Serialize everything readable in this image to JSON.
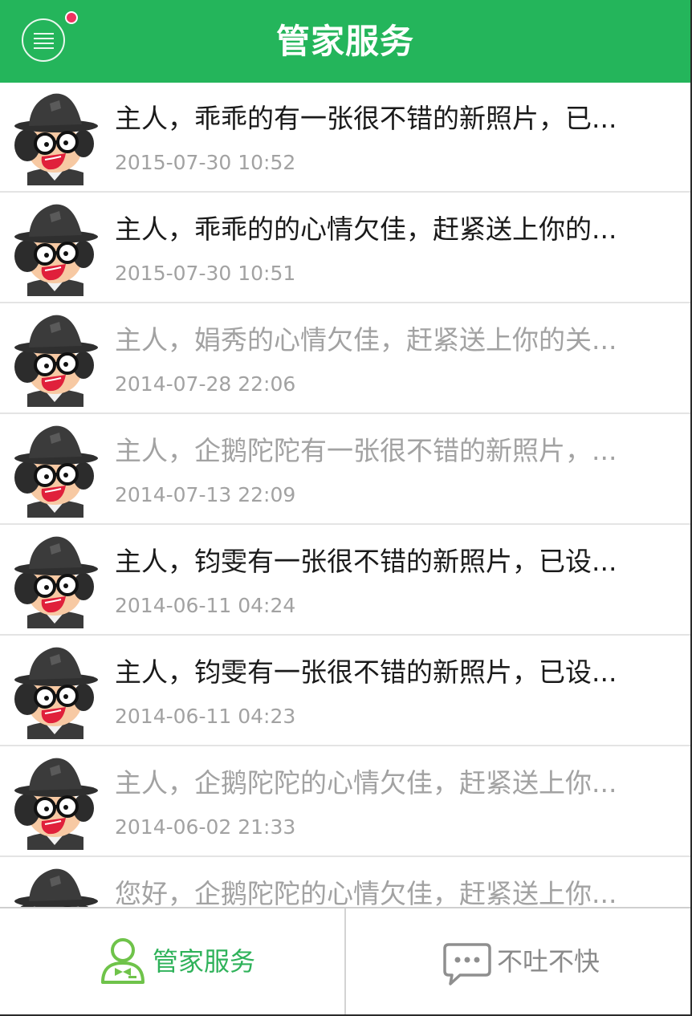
{
  "header": {
    "title": "管家服务",
    "menu_icon": "menu-icon",
    "has_notification": true
  },
  "messages": [
    {
      "text": "主人，乖乖的有一张很不错的新照片，已...",
      "time": "2015-07-30 10:52",
      "read": false
    },
    {
      "text": "主人，乖乖的的心情欠佳，赶紧送上你的...",
      "time": "2015-07-30 10:51",
      "read": false
    },
    {
      "text": "主人，娟秀的心情欠佳，赶紧送上你的关...",
      "time": "2014-07-28 22:06",
      "read": true
    },
    {
      "text": "主人，企鹅陀陀有一张很不错的新照片，...",
      "time": "2014-07-13 22:09",
      "read": true
    },
    {
      "text": "主人，钧雯有一张很不错的新照片，已设...",
      "time": "2014-06-11 04:24",
      "read": false
    },
    {
      "text": "主人，钧雯有一张很不错的新照片，已设...",
      "time": "2014-06-11 04:23",
      "read": false
    },
    {
      "text": "主人，企鹅陀陀的心情欠佳，赶紧送上你...",
      "time": "2014-06-02 21:33",
      "read": true
    },
    {
      "text": "您好，企鹅陀陀的心情欠佳，赶紧送上你...",
      "time": "",
      "read": true
    }
  ],
  "tabs": [
    {
      "label": "管家服务",
      "icon": "butler-icon",
      "active": true
    },
    {
      "label": "不吐不快",
      "icon": "chat-bubble-icon",
      "active": false
    }
  ],
  "colors": {
    "brand_green": "#24b55b",
    "active_tab": "#2fb25a",
    "notification_dot": "#f0325f",
    "unread_text": "#1a1a1a",
    "read_text": "#a2a2a2"
  }
}
